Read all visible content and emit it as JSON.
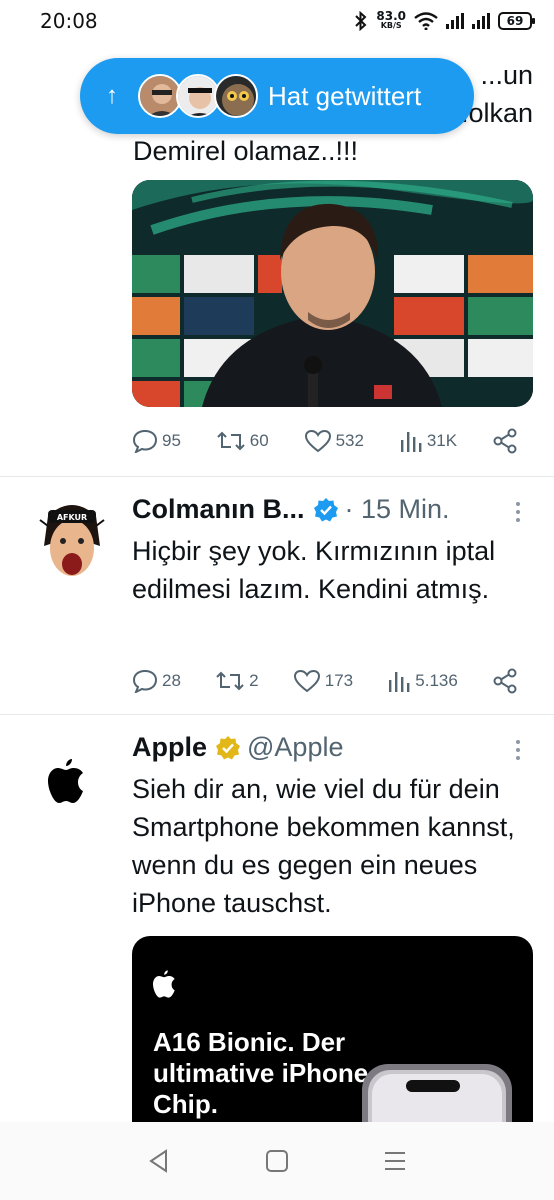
{
  "status": {
    "time": "20:08",
    "speed_value": "83.0",
    "speed_unit": "KB/S",
    "battery": "69",
    "icons": [
      "bluetooth-icon",
      "wifi-icon",
      "signal-icon",
      "signal-icon",
      "battery-icon"
    ]
  },
  "new_tweets_pill": {
    "label": "Hat getwittert",
    "icon": "arrow-up-icon"
  },
  "tweets": [
    {
      "text_lines": [
        "...un",
        "...olkan",
        "Demirel olamaz..!!!"
      ],
      "has_image": true,
      "replies": "95",
      "retweets": "60",
      "likes": "532",
      "views": "31K"
    },
    {
      "name": "Colmanın B...",
      "verified": true,
      "verified_color": "#1d9bf0",
      "time": "· 15 Min.",
      "text": "Hiçbir şey yok. Kırmızının iptal edilmesi lazım. Kendini atmış.",
      "replies": "28",
      "retweets": "2",
      "likes": "173",
      "views": "5.136"
    },
    {
      "name": "Apple",
      "verified": true,
      "verified_color": "#e2b719",
      "handle": "@Apple",
      "text": "Sieh dir an, wie viel du für dein Smartphone bekommen kannst, wenn du es gegen ein neues iPhone tauschst.",
      "promo": {
        "headline": "A16 Bionic. Der ultimative iPhone Chip."
      }
    }
  ],
  "colors": {
    "accent": "#1d9bf0",
    "secondary_text": "#536471",
    "divider": "#e6e9ec"
  },
  "navbar": {
    "icons": [
      "back-icon",
      "home-icon",
      "recents-icon"
    ]
  }
}
